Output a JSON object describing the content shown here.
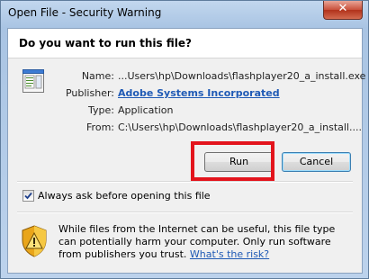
{
  "window": {
    "title": "Open File - Security Warning",
    "close_label": "✕"
  },
  "dialog": {
    "question": "Do you want to run this file?",
    "fields": {
      "name_label": "Name:",
      "name_value": "...Users\\hp\\Downloads\\flashplayer20_a_install.exe",
      "publisher_label": "Publisher:",
      "publisher_value": "Adobe Systems Incorporated",
      "type_label": "Type:",
      "type_value": "Application",
      "from_label": "From:",
      "from_value": "C:\\Users\\hp\\Downloads\\flashplayer20_a_install...."
    },
    "buttons": {
      "run": "Run",
      "cancel": "Cancel"
    },
    "checkbox": {
      "label": "Always ask before opening this file",
      "checked": true
    },
    "warning": {
      "text": "While files from the Internet can be useful, this file type can potentially harm your computer. Only run software from publishers you trust. ",
      "link": "What's the risk?"
    }
  },
  "colors": {
    "highlight_border": "#e3141c",
    "link": "#1f5ab5"
  },
  "icons": [
    "close-icon",
    "application-file-icon",
    "checkmark-icon",
    "security-shield-warning-icon"
  ]
}
